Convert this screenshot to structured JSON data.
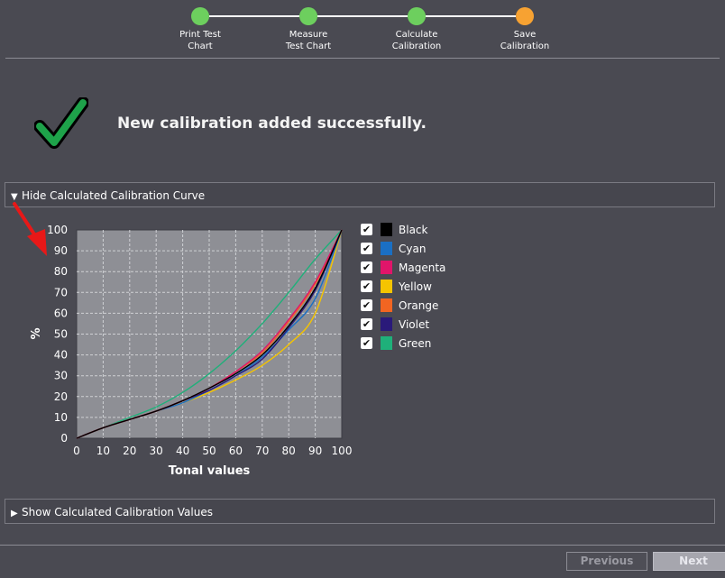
{
  "stepper": {
    "steps": [
      {
        "label": "Print Test\nChart",
        "state": "done"
      },
      {
        "label": "Measure\nTest Chart",
        "state": "done"
      },
      {
        "label": "Calculate\nCalibration",
        "state": "done"
      },
      {
        "label": "Save\nCalibration",
        "state": "active"
      }
    ],
    "colors": {
      "done": "#6dcf5e",
      "active": "#f7a232"
    }
  },
  "success": {
    "message": "New calibration added successfully.",
    "icon": "checkmark-icon"
  },
  "curve_section": {
    "label": "Hide Calculated Calibration Curve",
    "expanded": true
  },
  "values_section": {
    "label": "Show Calculated Calibration Values",
    "expanded": false
  },
  "chart_data": {
    "type": "line",
    "xlabel": "Tonal values",
    "ylabel": "%",
    "xlim": [
      0,
      100
    ],
    "ylim": [
      0,
      100
    ],
    "xticks": [
      0,
      10,
      20,
      30,
      40,
      50,
      60,
      70,
      80,
      90,
      100
    ],
    "yticks": [
      0,
      10,
      20,
      30,
      40,
      50,
      60,
      70,
      80,
      90,
      100
    ],
    "grid": true,
    "legend": "right",
    "x": [
      0,
      10,
      20,
      30,
      40,
      50,
      60,
      70,
      80,
      90,
      100
    ],
    "series": [
      {
        "name": "Black",
        "color": "#000000",
        "visible": true,
        "values": [
          0,
          5,
          9,
          13,
          18,
          24,
          31,
          40,
          54,
          72,
          100
        ]
      },
      {
        "name": "Cyan",
        "color": "#1a6fc4",
        "visible": true,
        "values": [
          0,
          5,
          9,
          13,
          17,
          23,
          30,
          39,
          52,
          67,
          100
        ]
      },
      {
        "name": "Magenta",
        "color": "#e0156a",
        "visible": true,
        "values": [
          0,
          5,
          9,
          13,
          18,
          24,
          32,
          42,
          57,
          75,
          100
        ]
      },
      {
        "name": "Yellow",
        "color": "#f5c400",
        "visible": true,
        "values": [
          0,
          5,
          9,
          13,
          17,
          22,
          28,
          35,
          45,
          60,
          100
        ]
      },
      {
        "name": "Orange",
        "color": "#f26522",
        "visible": true,
        "values": [
          0,
          5,
          9,
          13,
          18,
          24,
          32,
          41,
          56,
          74,
          100
        ]
      },
      {
        "name": "Violet",
        "color": "#2a1a7a",
        "visible": true,
        "values": [
          0,
          5,
          9,
          13,
          18,
          23,
          30,
          38,
          53,
          71,
          100
        ]
      },
      {
        "name": "Green",
        "color": "#1fb07a",
        "visible": true,
        "values": [
          0,
          5,
          10,
          15,
          22,
          31,
          42,
          55,
          70,
          86,
          100
        ]
      }
    ]
  },
  "footer": {
    "previous_label": "Previous",
    "next_label": "Next"
  }
}
